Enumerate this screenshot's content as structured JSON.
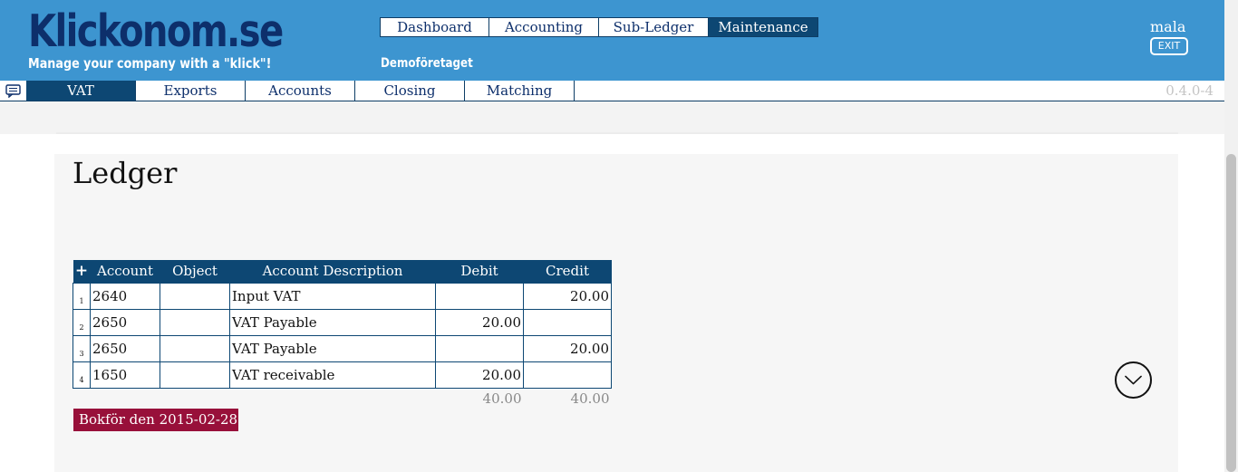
{
  "header": {
    "logo": "Klickonom.se",
    "tagline": "Manage your company with a \"klick\"!",
    "company": "Demoföretaget",
    "user": "mala",
    "exit_label": "EXIT",
    "main_tabs": [
      {
        "label": "Dashboard",
        "active": false
      },
      {
        "label": "Accounting",
        "active": false
      },
      {
        "label": "Sub-Ledger",
        "active": false
      },
      {
        "label": "Maintenance",
        "active": true
      }
    ]
  },
  "subnav": {
    "chat_icon": "chat-bubble-icon",
    "tabs": [
      {
        "label": "VAT",
        "active": true
      },
      {
        "label": "Exports",
        "active": false
      },
      {
        "label": "Accounts",
        "active": false
      },
      {
        "label": "Closing",
        "active": false
      },
      {
        "label": "Matching",
        "active": false
      }
    ],
    "version": "0.4.0-4"
  },
  "main": {
    "title": "Ledger",
    "table": {
      "add_icon": "+",
      "columns": [
        "Account",
        "Object",
        "Account Description",
        "Debit",
        "Credit"
      ],
      "rows": [
        {
          "n": "1",
          "account": "2640",
          "object": "",
          "description": "Input VAT",
          "debit": "",
          "credit": "20.00"
        },
        {
          "n": "2",
          "account": "2650",
          "object": "",
          "description": "VAT Payable",
          "debit": "20.00",
          "credit": ""
        },
        {
          "n": "3",
          "account": "2650",
          "object": "",
          "description": "VAT Payable",
          "debit": "",
          "credit": "20.00"
        },
        {
          "n": "4",
          "account": "1650",
          "object": "",
          "description": "VAT receivable",
          "debit": "20.00",
          "credit": ""
        }
      ],
      "totals": {
        "debit": "40.00",
        "credit": "40.00"
      }
    },
    "post_button": "Bokför den 2015-02-28",
    "scroll_icon": "chevron-down-circle-icon"
  },
  "colors": {
    "header_bg": "#3d95d0",
    "nav_active": "#0d4773",
    "logo": "#0d2f6b",
    "post_button": "#98103a"
  }
}
